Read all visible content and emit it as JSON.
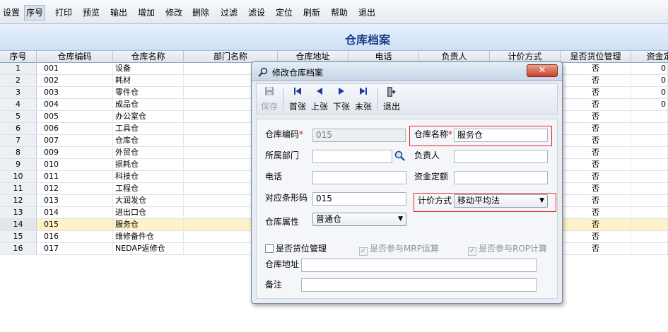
{
  "menu": {
    "items": [
      {
        "id": "settings",
        "label": "设置"
      },
      {
        "id": "seq",
        "label": "序号"
      },
      {
        "id": "print",
        "label": "打印"
      },
      {
        "id": "preview",
        "label": "预览"
      },
      {
        "id": "export",
        "label": "输出"
      },
      {
        "id": "add",
        "label": "增加"
      },
      {
        "id": "edit",
        "label": "修改"
      },
      {
        "id": "delete",
        "label": "删除"
      },
      {
        "id": "filter",
        "label": "过滤"
      },
      {
        "id": "filterset",
        "label": "滤设"
      },
      {
        "id": "locate",
        "label": "定位"
      },
      {
        "id": "refresh",
        "label": "刷新"
      },
      {
        "id": "help",
        "label": "帮助"
      },
      {
        "id": "exit",
        "label": "退出"
      }
    ],
    "active": "seq"
  },
  "page_title": "仓库档案",
  "grid": {
    "columns": [
      "序号",
      "仓库编码",
      "仓库名称",
      "部门名称",
      "仓库地址",
      "电话",
      "负责人",
      "计价方式",
      "是否货位管理",
      "资金定"
    ],
    "rows": [
      {
        "seq": "1",
        "code": "001",
        "name": "设备",
        "loc": "否",
        "fund": "0"
      },
      {
        "seq": "2",
        "code": "002",
        "name": "耗材",
        "loc": "否",
        "fund": "0"
      },
      {
        "seq": "3",
        "code": "003",
        "name": "零件仓",
        "loc": "否",
        "fund": "0"
      },
      {
        "seq": "4",
        "code": "004",
        "name": "成品仓",
        "loc": "否",
        "fund": "0"
      },
      {
        "seq": "5",
        "code": "005",
        "name": "办公室仓",
        "loc": "否",
        "fund": ""
      },
      {
        "seq": "6",
        "code": "006",
        "name": "工具仓",
        "loc": "否",
        "fund": ""
      },
      {
        "seq": "7",
        "code": "007",
        "name": "仓库仓",
        "loc": "否",
        "fund": ""
      },
      {
        "seq": "8",
        "code": "009",
        "name": "外贸仓",
        "loc": "否",
        "fund": ""
      },
      {
        "seq": "9",
        "code": "010",
        "name": "损耗仓",
        "loc": "否",
        "fund": ""
      },
      {
        "seq": "10",
        "code": "011",
        "name": "科技仓",
        "loc": "否",
        "fund": ""
      },
      {
        "seq": "11",
        "code": "012",
        "name": "工程仓",
        "loc": "否",
        "fund": ""
      },
      {
        "seq": "12",
        "code": "013",
        "name": "大润发仓",
        "loc": "否",
        "fund": ""
      },
      {
        "seq": "13",
        "code": "014",
        "name": "进出口仓",
        "loc": "否",
        "fund": ""
      },
      {
        "seq": "14",
        "code": "015",
        "name": "服务仓",
        "loc": "否",
        "fund": "",
        "selected": true
      },
      {
        "seq": "15",
        "code": "016",
        "name": "维修备件仓",
        "loc": "否",
        "fund": ""
      },
      {
        "seq": "16",
        "code": "017",
        "name": "NEDAP返修仓",
        "loc": "否",
        "fund": ""
      }
    ]
  },
  "dialog": {
    "title": "修改仓库档案",
    "close_label": "✕",
    "toolbar": {
      "save": "保存",
      "first": "首张",
      "prev": "上张",
      "next": "下张",
      "last": "末张",
      "exit": "退出"
    },
    "form": {
      "code_label": "仓库编码",
      "code_value": "015",
      "name_label": "仓库名称",
      "name_value": "服务仓",
      "dept_label": "所属部门",
      "dept_value": "",
      "manager_label": "负责人",
      "manager_value": "",
      "phone_label": "电话",
      "phone_value": "",
      "fund_label": "资金定额",
      "fund_value": "",
      "barcode_label": "对应条形码",
      "barcode_value": "015",
      "pricing_label": "计价方式",
      "pricing_value": "移动平均法",
      "attr_label": "仓库属性",
      "attr_value": "普通仓",
      "required_mark": "*",
      "chk_location": "是否货位管理",
      "chk_mrp": "是否参与MRP运算",
      "chk_rop": "是否参与ROP计算",
      "address_label": "仓库地址",
      "address_value": "",
      "remark_label": "备注",
      "remark_value": ""
    }
  },
  "colors": {
    "title_text": "#1b3d8a",
    "selected_row": "#fff1c8",
    "highlight_border": "#e0262a"
  }
}
